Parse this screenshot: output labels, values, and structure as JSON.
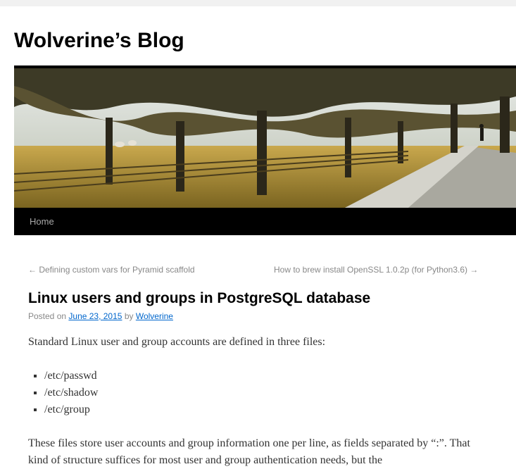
{
  "site": {
    "title": "Wolverine’s Blog"
  },
  "nav": {
    "items": [
      {
        "label": "Home"
      }
    ]
  },
  "post_nav": {
    "prev_arrow": "←",
    "prev_label": "Defining custom vars for Pyramid scaffold",
    "next_label": "How to brew install OpenSSL 1.0.2p (for Python3.6)",
    "next_arrow": "→"
  },
  "post": {
    "title": "Linux users and groups in PostgreSQL database",
    "meta": {
      "posted_on": "Posted on",
      "date": "June 23, 2015",
      "by": "by",
      "author": "Wolverine"
    },
    "intro": "Standard Linux user and group accounts are defined in three files:",
    "files": [
      "/etc/passwd",
      "/etc/shadow",
      "/etc/group"
    ],
    "paragraph2": "These files store user accounts and group information one per line, as fields separated by “:”. That kind of structure suffices for most user and group authentication needs, but the"
  },
  "colors": {
    "link": "#0066cc",
    "nav_bg": "#000000",
    "meta": "#888888",
    "body_text": "#333333"
  }
}
